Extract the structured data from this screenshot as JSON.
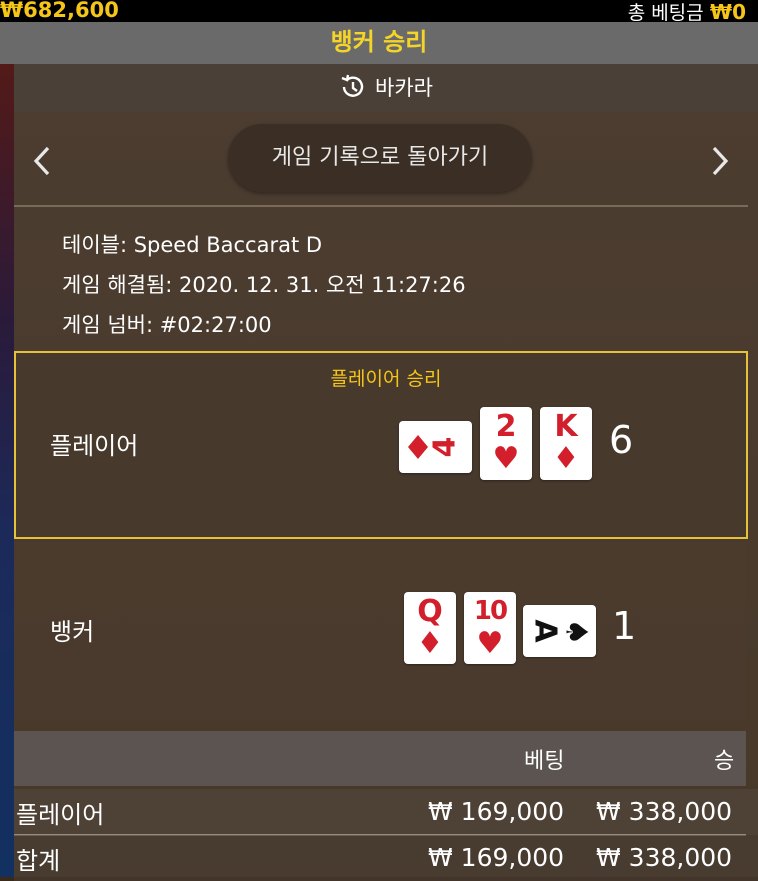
{
  "top_bar": {
    "balance": "₩682,600",
    "total_bet_label": "총 베팅금",
    "total_bet_value": "₩0"
  },
  "result_banner": "뱅커 승리",
  "subheader": {
    "title": "바카라",
    "icon": "history-icon"
  },
  "navigation": {
    "prev_icon": "chevron-left-icon",
    "next_icon": "chevron-right-icon",
    "back_button_label": "게임 기록으로 돌아가기"
  },
  "info": {
    "table": "테이블: Speed Baccarat D",
    "resolved": "게임 해결됨: 2020. 12. 31. 오전 11:27:26",
    "game_number": "게임 넘버: #02:27:00"
  },
  "player": {
    "win_label": "플레이어 승리",
    "label": "플레이어",
    "score": "6",
    "cards": [
      {
        "rank": "4",
        "suit": "♦",
        "color": "#d21f2b",
        "orientation": "rotated"
      },
      {
        "rank": "2",
        "suit": "♥",
        "color": "#d21f2b",
        "orientation": "upright"
      },
      {
        "rank": "K",
        "suit": "♦",
        "color": "#d21f2b",
        "orientation": "upright"
      }
    ]
  },
  "banker": {
    "label": "뱅커",
    "score": "1",
    "cards": [
      {
        "rank": "Q",
        "suit": "♦",
        "color": "#d21f2b",
        "orientation": "upright"
      },
      {
        "rank": "10",
        "suit": "♥",
        "color": "#d21f2b",
        "orientation": "upright"
      },
      {
        "rank": "A",
        "suit": "♠",
        "color": "#111111",
        "orientation": "rotated"
      }
    ]
  },
  "bets_table": {
    "headers": [
      "베팅",
      "승"
    ],
    "rows": [
      {
        "name": "플레이어",
        "bet": "₩ 169,000",
        "win": "₩ 338,000"
      },
      {
        "name": "합계",
        "bet": "₩ 169,000",
        "win": "₩ 338,000"
      }
    ]
  },
  "colors": {
    "accent_gold": "#f5c518",
    "banner_text": "#f5d42a",
    "card_red": "#d21f2b",
    "highlight_border": "#e6c23a"
  }
}
